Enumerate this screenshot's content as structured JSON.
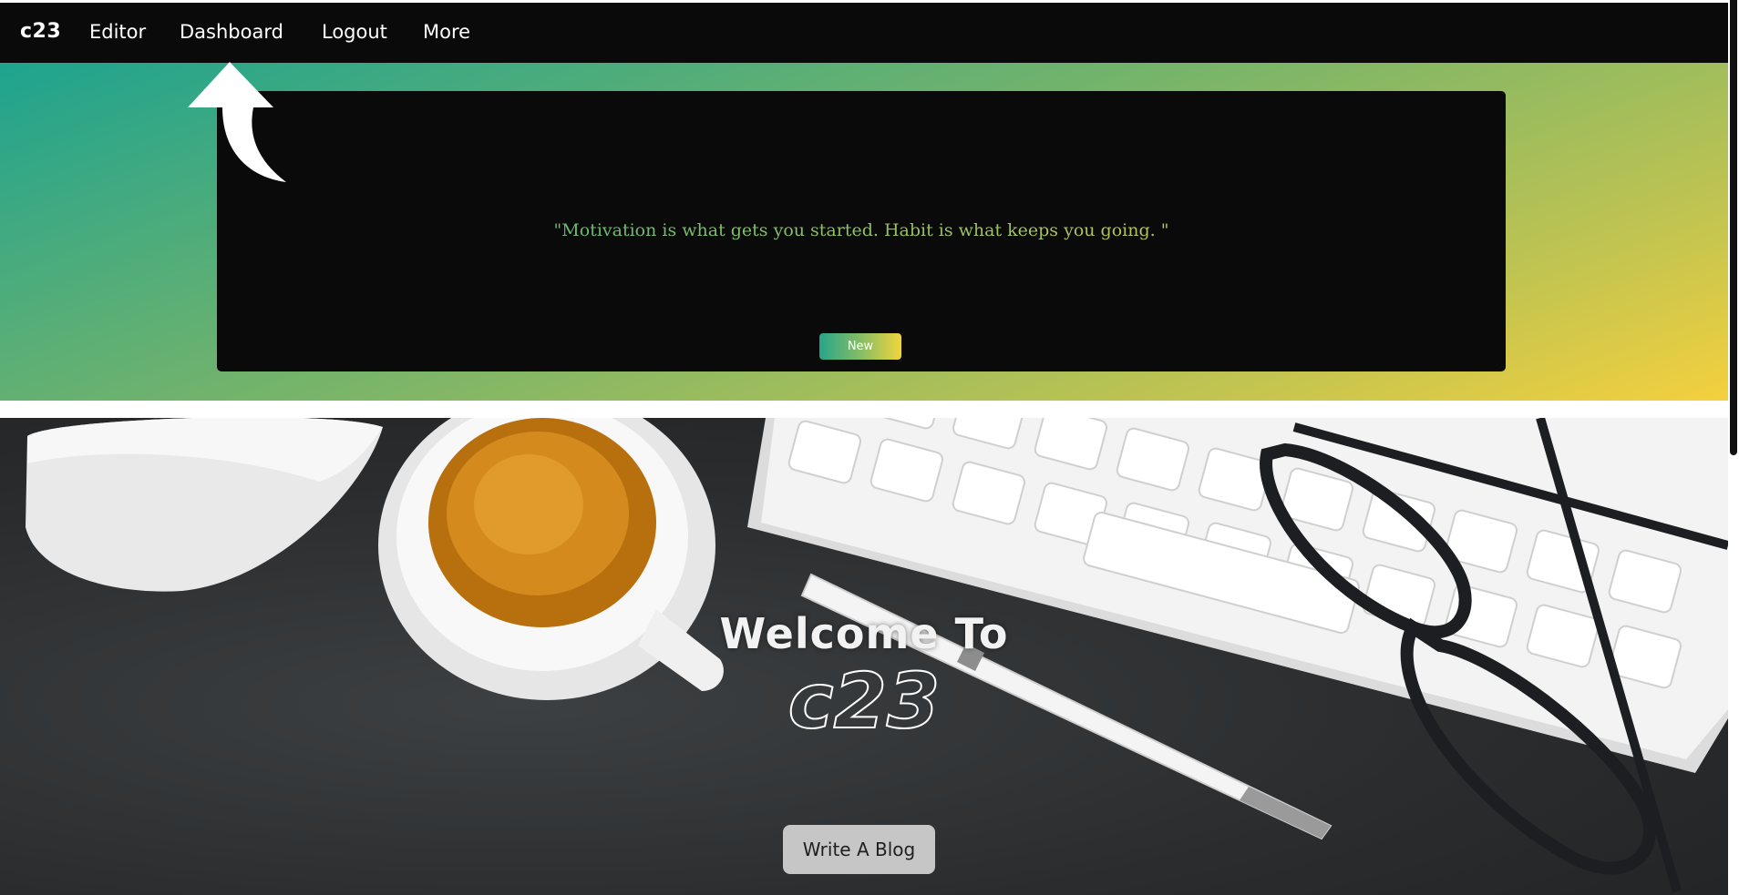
{
  "navbar": {
    "brand": "c23",
    "links": [
      "Editor",
      "Dashboard",
      "Logout",
      "More"
    ]
  },
  "quote_section": {
    "quote": "\"Motivation is what gets you started. Habit is what keeps you going. \"",
    "new_button": "New"
  },
  "hero": {
    "welcome": "Welcome To",
    "name": "c23",
    "write_button": "Write A Blog"
  },
  "annotations": {
    "arrow": "arrow-up-icon"
  },
  "colors": {
    "navbar_bg": "#0b0a0b",
    "gradient_start": "#1ea38f",
    "gradient_end": "#f4d03e",
    "card_bg": "#0b0a0b",
    "write_button_bg": "#c6c6c6"
  }
}
